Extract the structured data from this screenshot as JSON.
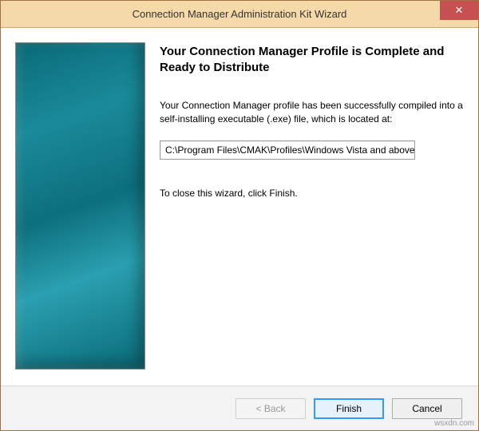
{
  "window": {
    "title": "Connection Manager Administration Kit Wizard",
    "close_tooltip": "Close"
  },
  "content": {
    "heading": "Your Connection Manager Profile is Complete and Ready to Distribute",
    "paragraph": "Your Connection Manager profile has been successfully compiled into a self-installing executable (.exe) file, which is located at:",
    "path_value": "C:\\Program Files\\CMAK\\Profiles\\Windows Vista and above\\",
    "finish_hint": "To close this wizard, click Finish."
  },
  "buttons": {
    "back": "< Back",
    "finish": "Finish",
    "cancel": "Cancel"
  },
  "watermark": "wsxdn.com"
}
